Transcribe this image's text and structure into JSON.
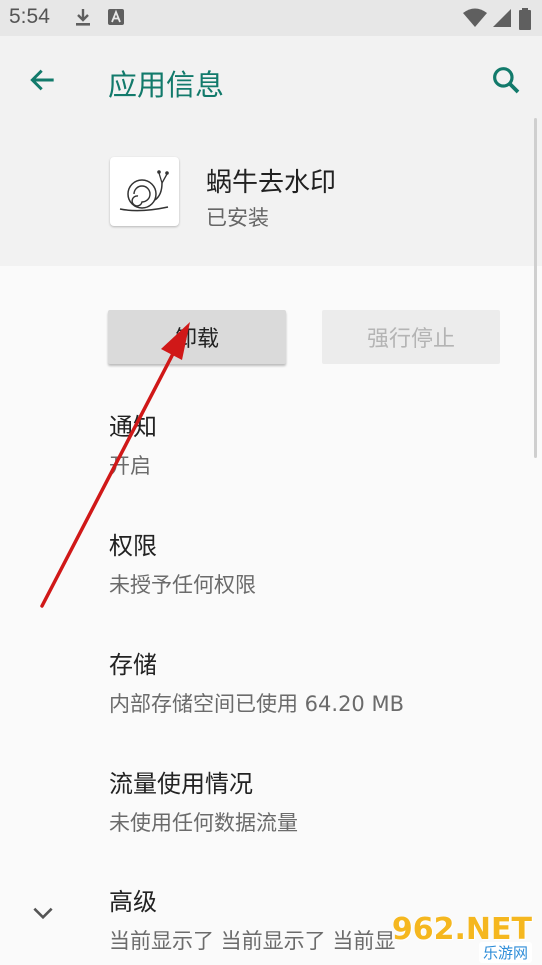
{
  "status_bar": {
    "time": "5:54",
    "left_icons": [
      "download-icon",
      "a-notification-icon"
    ],
    "right_icons": [
      "wifi-icon",
      "signal-icon",
      "battery-icon"
    ]
  },
  "app_bar": {
    "title": "应用信息",
    "accent_color": "#127a6b"
  },
  "app": {
    "name": "蜗牛去水印",
    "status": "已安装",
    "icon": "snail-icon"
  },
  "buttons": {
    "uninstall": "卸载",
    "force_stop": "强行停止"
  },
  "items": [
    {
      "title": "通知",
      "subtitle": "开启"
    },
    {
      "title": "权限",
      "subtitle": "未授予任何权限"
    },
    {
      "title": "存储",
      "subtitle": "内部存储空间已使用 64.20 MB"
    },
    {
      "title": "流量使用情况",
      "subtitle": "未使用任何数据流量"
    },
    {
      "title": "高级",
      "subtitle": "当前显示了 当前显示了 当前显"
    }
  ],
  "annotation": {
    "color": "#d01818"
  },
  "watermark": {
    "main": "962.NET",
    "sub": "乐游网"
  }
}
